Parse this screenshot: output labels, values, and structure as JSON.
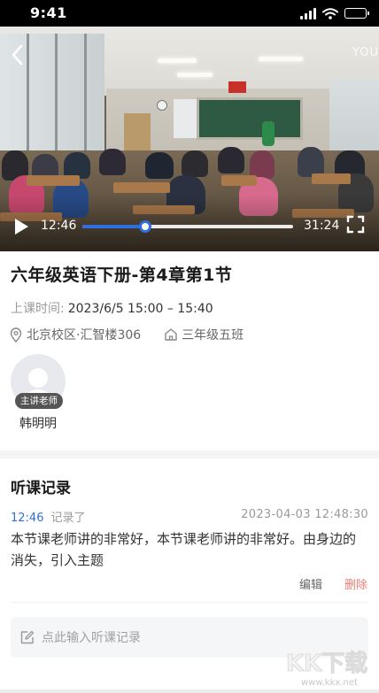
{
  "status_bar": {
    "time": "9:41"
  },
  "video": {
    "watermark": "YOU",
    "current_time": "12:46",
    "total_time": "31:24",
    "progress": 0.3
  },
  "lesson": {
    "title": "六年级英语下册-第4章第1节",
    "time_label": "上课时间:",
    "time_value": "2023/6/5  15:00 – 15:40",
    "location": "北京校区·汇智楼306",
    "class_name": "三年级五班"
  },
  "teacher": {
    "role_badge": "主讲老师",
    "name": "韩明明"
  },
  "records": {
    "section_title": "听课记录",
    "items": [
      {
        "video_time": "12:46",
        "action": "记录了",
        "datetime": "2023-04-03  12:48:30",
        "content": "本节课老师讲的非常好，本节课老师讲的非常好。由身边的消失，引入主题",
        "edit_label": "编辑",
        "delete_label": "删除"
      }
    ],
    "input_placeholder": "点此输入听课记录"
  },
  "watermark": {
    "logo_text": "KK下载",
    "url": "www.kkx.net"
  },
  "colors": {
    "accent": "#2f6ee0",
    "danger": "#f27c73",
    "muted": "#9a9a9a"
  },
  "icons": [
    "back-icon",
    "play-icon",
    "fullscreen-icon",
    "location-pin-icon",
    "classroom-icon",
    "edit-note-icon"
  ]
}
